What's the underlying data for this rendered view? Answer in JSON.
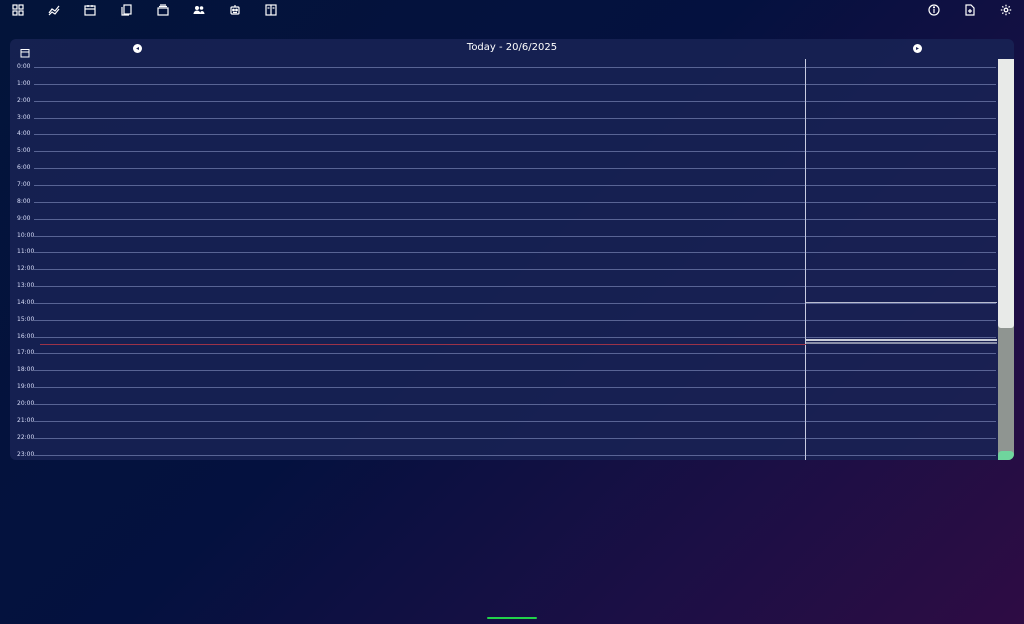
{
  "toolbar": {
    "left_icons": [
      "dashboard-icon",
      "trend-icon",
      "calendar-icon",
      "documents-icon",
      "layers-icon",
      "people-icon",
      "robot-icon",
      "columns-icon"
    ],
    "right_icons": [
      "info-icon",
      "file-icon",
      "settings-icon"
    ]
  },
  "calendar": {
    "title": "Today - 20/6/2025",
    "prev_symbol": "◂",
    "next_symbol": "▸",
    "hours": [
      "0:00",
      "1:00",
      "2:00",
      "3:00",
      "4:00",
      "5:00",
      "6:00",
      "7:00",
      "8:00",
      "9:00",
      "10:00",
      "11:00",
      "12:00",
      "13:00",
      "14:00",
      "15:00",
      "16:00",
      "17:00",
      "18:00",
      "19:00",
      "20:00",
      "21:00",
      "22:00",
      "23:00"
    ],
    "now_hour": 16.45
  },
  "colors": {
    "now_line": "#9b3248",
    "scroll_accent": "#6fd59d",
    "home_indicator": "#22d24a"
  }
}
